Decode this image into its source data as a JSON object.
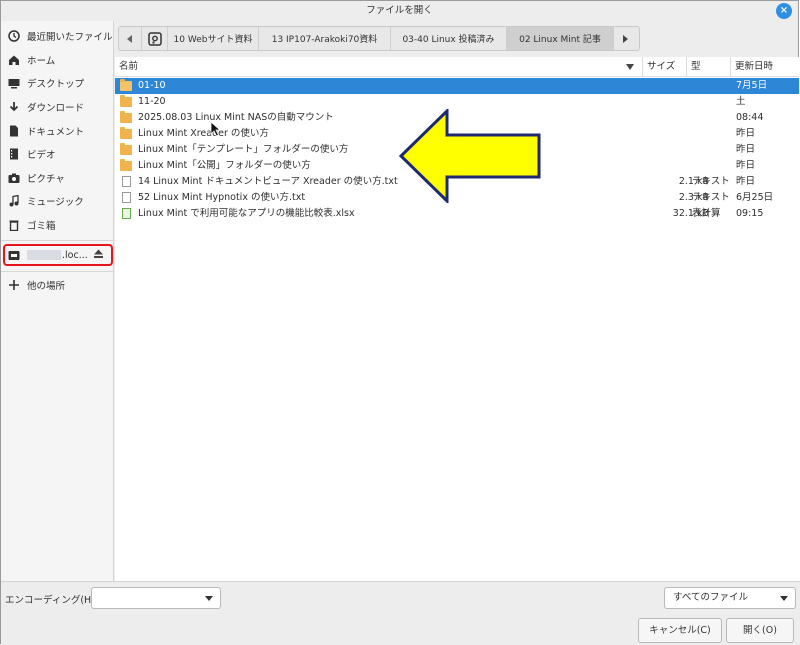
{
  "window": {
    "title": "ファイルを開く",
    "close_glyph": "×"
  },
  "sidebar": {
    "items": [
      {
        "label": "最近開いたファイル",
        "icon": "clock-icon"
      },
      {
        "label": "ホーム",
        "icon": "home-icon"
      },
      {
        "label": "デスクトップ",
        "icon": "desktop-icon"
      },
      {
        "label": "ダウンロード",
        "icon": "download-icon"
      },
      {
        "label": "ドキュメント",
        "icon": "document-icon"
      },
      {
        "label": "ビデオ",
        "icon": "video-icon"
      },
      {
        "label": "ピクチャ",
        "icon": "camera-icon"
      },
      {
        "label": "ミュージック",
        "icon": "music-icon"
      },
      {
        "label": "ゴミ箱",
        "icon": "trash-icon"
      }
    ],
    "network_drive": {
      "label": ".loc...",
      "icon": "network-drive-icon"
    },
    "other_places": {
      "label": "他の場所",
      "icon": "plus-icon"
    }
  },
  "pathbar": {
    "segments": [
      {
        "label": "10 Webサイト資料"
      },
      {
        "label": "13 IP107-Arakoki70資料"
      },
      {
        "label": "03-40 Linux 投稿済み"
      },
      {
        "label": "02 Linux Mint 記事"
      }
    ]
  },
  "list": {
    "headers": {
      "name": "名前",
      "size": "サイズ",
      "type": "型",
      "modified": "更新日時"
    },
    "rows": [
      {
        "name": "01-10",
        "size": "",
        "type": "",
        "modified": "7月5日",
        "kind": "folder"
      },
      {
        "name": "11-20",
        "size": "",
        "type": "",
        "modified": "土",
        "kind": "folder"
      },
      {
        "name": "2025.08.03 Linux Mint NASの自動マウント",
        "size": "",
        "type": "",
        "modified": "08:44",
        "kind": "folder"
      },
      {
        "name": "Linux Mint Xreader の使い方",
        "size": "",
        "type": "",
        "modified": "昨日",
        "kind": "folder"
      },
      {
        "name": "Linux Mint「テンプレート」フォルダーの使い方",
        "size": "",
        "type": "",
        "modified": "昨日",
        "kind": "folder"
      },
      {
        "name": "Linux Mint「公開」フォルダーの使い方",
        "size": "",
        "type": "",
        "modified": "昨日",
        "kind": "folder"
      },
      {
        "name": "14 Linux Mint ドキュメントビューア Xreader の使い方.txt",
        "size": "2.1 kB",
        "type": "テキスト",
        "modified": "昨日",
        "kind": "text"
      },
      {
        "name": "52 Linux Mint Hypnotix の使い方.txt",
        "size": "2.3 kB",
        "type": "テキスト",
        "modified": "6月25日",
        "kind": "text"
      },
      {
        "name": "Linux Mint で利用可能なアプリの機能比較表.xlsx",
        "size": "32.1 kB",
        "type": "表計算",
        "modified": "09:15",
        "kind": "spreadsheet"
      }
    ]
  },
  "bottom": {
    "encoding_label": "エンコーディング(H):",
    "encoding_value": "",
    "filter_value": "すべてのファイル",
    "cancel_label": "キャンセル(C)",
    "open_label": "開く(O)"
  },
  "colors": {
    "selection": "#2d86d6",
    "annotation_arrow": "#ffff00",
    "highlight_box": "#e8141b"
  }
}
